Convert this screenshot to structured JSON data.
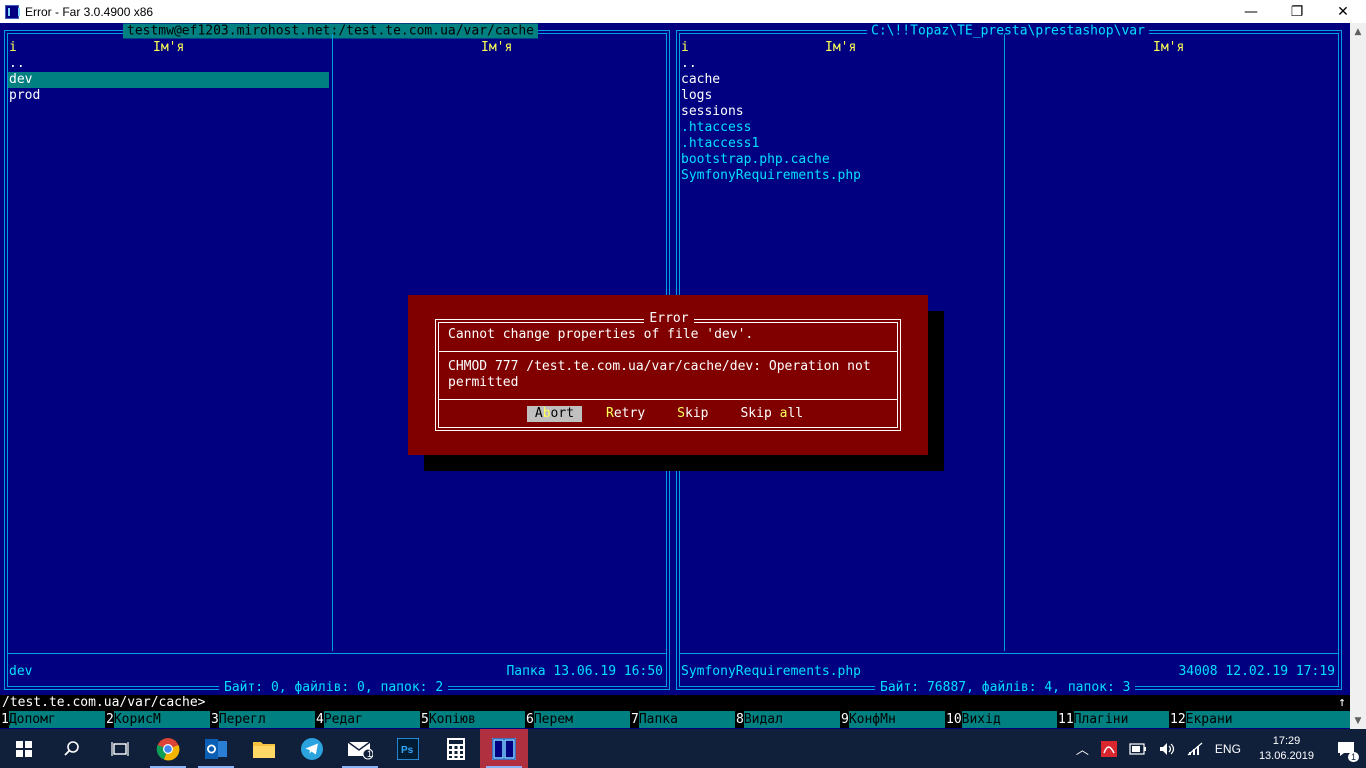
{
  "window": {
    "title": "Error - Far 3.0.4900 x86",
    "minimize_glyph": "—",
    "maximize_glyph": "❐",
    "close_glyph": "✕"
  },
  "left_panel": {
    "path": "testmw@ef1203.mirohost.net:/test.te.com.ua/var/cache",
    "col_i": "i",
    "col_name_1": "Ім'я",
    "col_name_2": "Ім'я",
    "files": [
      "..",
      "dev",
      "prod"
    ],
    "selected_name": "dev",
    "selected_info": "Папка 13.06.19 16:50",
    "summary": "Байт: 0, файлів: 0, папок: 2"
  },
  "right_panel": {
    "path": "C:\\!!Topaz\\TE_presta\\prestashop\\var",
    "col_i": "i",
    "col_name_1": "Ім'я",
    "col_name_2": "Ім'я",
    "folders": [
      "..",
      "cache",
      "logs",
      "sessions"
    ],
    "files": [
      ".htaccess",
      ".htaccess1",
      "bootstrap.php.cache",
      "SymfonyRequirements.php"
    ],
    "selected_name": "SymfonyRequirements.php",
    "selected_info": "34008 12.02.19 17:19",
    "summary": "Байт: 76887, файлів: 4, папок: 3"
  },
  "dialog": {
    "title": "Error",
    "message": "Cannot change properties of file 'dev'.",
    "detail_line1": "CHMOD 777 /test.te.com.ua/var/cache/dev: Operation not",
    "detail_line2": "permitted",
    "buttons": {
      "abort_pre": "A",
      "abort_hot": "b",
      "abort_post": "ort",
      "retry_hot": "R",
      "retry_post": "etry",
      "skip_hot": "S",
      "skip_post": "kip",
      "skipall_pre": "Skip ",
      "skipall_hot": "a",
      "skipall_post": "ll"
    }
  },
  "command_line": "/test.te.com.ua/var/cache>",
  "scroll_up": "↑",
  "keybar": [
    {
      "num": "1",
      "label": "Допомг"
    },
    {
      "num": "2",
      "label": "КорисМ"
    },
    {
      "num": "3",
      "label": "Перегл"
    },
    {
      "num": "4",
      "label": "Редаг"
    },
    {
      "num": "5",
      "label": "Копіюв"
    },
    {
      "num": "6",
      "label": "Перем"
    },
    {
      "num": "7",
      "label": "Папка"
    },
    {
      "num": "8",
      "label": "Видал"
    },
    {
      "num": "9",
      "label": "КонфМн"
    },
    {
      "num": "10",
      "label": "Вихід"
    },
    {
      "num": "11",
      "label": "Плагіни"
    },
    {
      "num": "12",
      "label": "Екрани"
    }
  ],
  "taskbar": {
    "language": "ENG",
    "time": "17:29",
    "date": "13.06.2019",
    "mail_badge": "1",
    "notification_count": "1"
  }
}
